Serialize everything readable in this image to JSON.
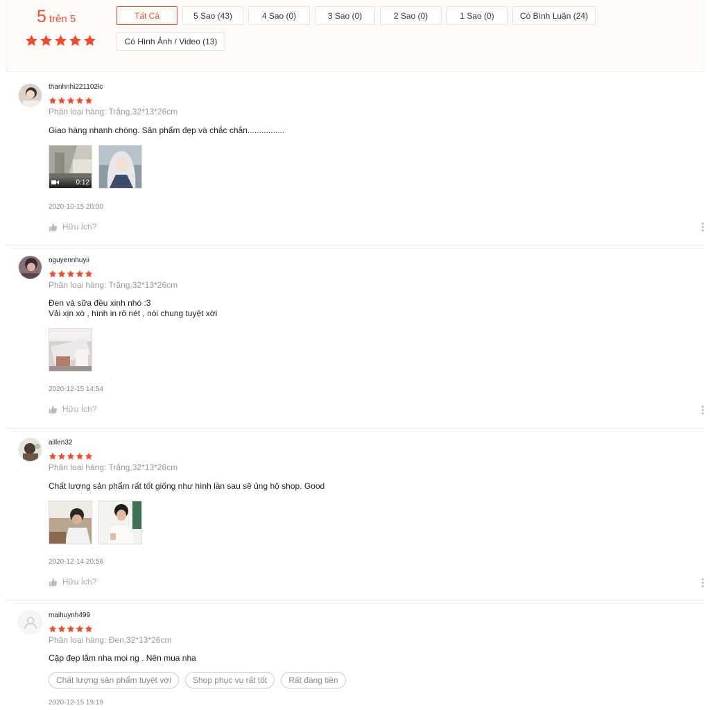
{
  "summary": {
    "score": "5",
    "score_suffix": "trên 5",
    "stars": 5,
    "filters": [
      {
        "label": "Tất Cả",
        "active": true
      },
      {
        "label": "5 Sao (43)"
      },
      {
        "label": "4 Sao (0)"
      },
      {
        "label": "3 Sao (0)"
      },
      {
        "label": "2 Sao (0)"
      },
      {
        "label": "1 Sao (0)"
      },
      {
        "label": "Có Bình Luận (24)"
      },
      {
        "label": "Có Hình Ảnh / Video (13)"
      }
    ]
  },
  "colors": {
    "accent": "#ee4d2d",
    "muted": "#999999"
  },
  "reviews": [
    {
      "username": "thanhnhi221102lc",
      "rating": 5,
      "variation": "Phân loại hàng: Trắng,32*13*26cm",
      "comment": "Giao hàng nhanh chóng. Sản phẩm đẹp và chắc chắn................",
      "video_duration": "0:12",
      "date": "2020-10-15 20:00",
      "helpful": "Hữu Ích?"
    },
    {
      "username": "nguyennhuyii",
      "rating": 5,
      "variation": "Phân loại hàng: Trắng,32*13*26cm",
      "comment": "Đen và sữa đều xinh nhó :3\nVải xịn xò , hình in rõ nét , nói chung tuyệt xời",
      "date": "2020-12-15 14:54",
      "helpful": "Hữu Ích?"
    },
    {
      "username": "aillen32",
      "rating": 5,
      "variation": "Phân loại hàng: Trắng,32*13*26cm",
      "comment": "Chất lượng sản phẩm rất tốt giống như hình lần sau sẽ ủng hộ shop. Good",
      "date": "2020-12-14 20:56",
      "helpful": "Hữu Ích?"
    },
    {
      "username": "maihuynh499",
      "rating": 5,
      "variation": "Phân loại hàng: Đen,32*13*26cm",
      "comment": "Cặp đẹp lắm nha mọi ng . Nên mua nha",
      "tags": [
        "Chất lượng sản phẩm tuyệt vời",
        "Shop phục vụ rất tốt",
        "Rất đáng tiền"
      ],
      "date": "2020-12-15 19:19"
    }
  ]
}
